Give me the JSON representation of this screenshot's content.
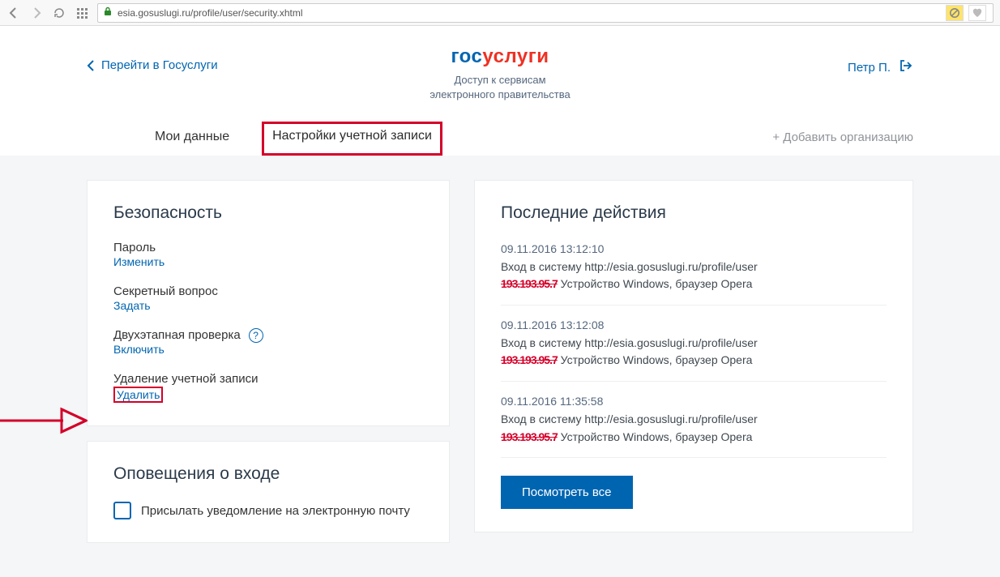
{
  "browser": {
    "url": "esia.gosuslugi.ru/profile/user/security.xhtml"
  },
  "header": {
    "back_label": "Перейти в Госуслуги",
    "logo_part1": "гос",
    "logo_part2": "услуги",
    "subtitle_line1": "Доступ к сервисам",
    "subtitle_line2": "электронного правительства",
    "user_name": "Петр П."
  },
  "tabs": {
    "t1": "Мои данные",
    "t2": "Настройки учетной записи",
    "add_org": "+ Добавить организацию"
  },
  "security": {
    "title": "Безопасность",
    "password_label": "Пароль",
    "password_action": "Изменить",
    "secret_label": "Секретный вопрос",
    "secret_action": "Задать",
    "twostep_label": "Двухэтапная проверка",
    "twostep_action": "Включить",
    "delete_label": "Удаление учетной записи",
    "delete_action": "Удалить"
  },
  "notify": {
    "title": "Оповещения о входе",
    "checkbox_label": "Присылать уведомление на электронную почту"
  },
  "activity": {
    "title": "Последние действия",
    "items": [
      {
        "time": "09.11.2016 13:12:10",
        "line1": "Вход в систему http://esia.gosuslugi.ru/profile/user",
        "line2_after": " Устройство Windows, браузер Opera"
      },
      {
        "time": "09.11.2016 13:12:08",
        "line1": "Вход в систему http://esia.gosuslugi.ru/profile/user",
        "line2_after": " Устройство Windows, браузер Opera"
      },
      {
        "time": "09.11.2016 11:35:58",
        "line1": "Вход в систему http://esia.gosuslugi.ru/profile/user",
        "line2_after": " Устройство Windows, браузер Opera"
      }
    ],
    "view_all": "Посмотреть все"
  }
}
